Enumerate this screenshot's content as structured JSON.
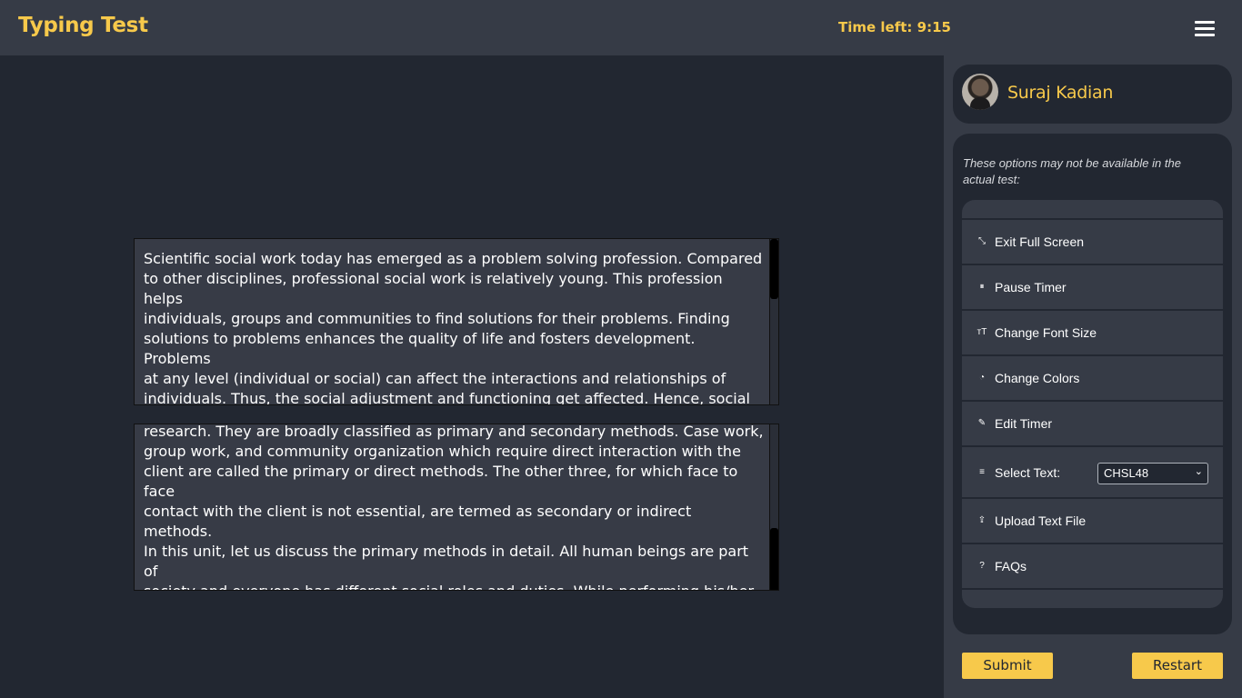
{
  "header": {
    "title": "Typing Test",
    "timer": "Time left: 9:15",
    "menu_icon": "hamburger-menu-icon"
  },
  "reference_text": "Scientific social work today has emerged as a problem solving profession. Compared\nto other disciplines, professional social work is relatively young. This profession helps\nindividuals, groups and communities to find solutions for their problems. Finding\nsolutions to problems enhances the quality of life and fosters development. Problems\nat any level (individual or social) can affect the interactions and relationships of\nindividuals. Thus, the social adjustment and functioning get affected. Hence, social\nwork intervention in solving problems promotes social functioning of individuals.\nSocial work, over years has evolved a scientific knowledge base, clear skill sets and a",
  "typed_text": "research. They are broadly classified as primary and secondary methods. Case work,\ngroup work, and community organization which require direct interaction with the\nclient are called the primary or direct methods. The other three, for which face to face\ncontact with the client is not essential, are termed as secondary or indirect methods.\nIn this unit, let us discuss the primary methods in detail. All human beings are part of\nsociety and everyone has different social roles and duties. While performing his/her\nduties and roles, individual faces many problems in one form or the other. Every\nindividual reacts differently to his/her social, physical",
  "sidebar": {
    "user_name": "Suraj Kadian",
    "note": "These options may not be available in the actual test:",
    "options": [
      {
        "label": "Exit Full Screen",
        "icon": "compress-icon",
        "glyph": "⤡"
      },
      {
        "label": "Pause Timer",
        "icon": "pause-icon",
        "glyph": "⏸"
      },
      {
        "label": "Change Font Size",
        "icon": "font-size-icon",
        "glyph": "ᴛT"
      },
      {
        "label": "Change Colors",
        "icon": "palette-icon",
        "glyph": "◔"
      },
      {
        "label": "Edit Timer",
        "icon": "edit-icon",
        "glyph": "✎"
      },
      {
        "label": "Select Text:",
        "icon": "list-icon",
        "glyph": "≡"
      },
      {
        "label": "Upload Text File",
        "icon": "upload-icon",
        "glyph": "⇪"
      },
      {
        "label": "FAQs",
        "icon": "help-icon",
        "glyph": "?"
      }
    ],
    "select_value": "CHSL48"
  },
  "buttons": {
    "submit": "Submit",
    "restart": "Restart"
  },
  "colors": {
    "accent": "#f7c94b",
    "background": "#222731",
    "panel": "#363b46"
  }
}
